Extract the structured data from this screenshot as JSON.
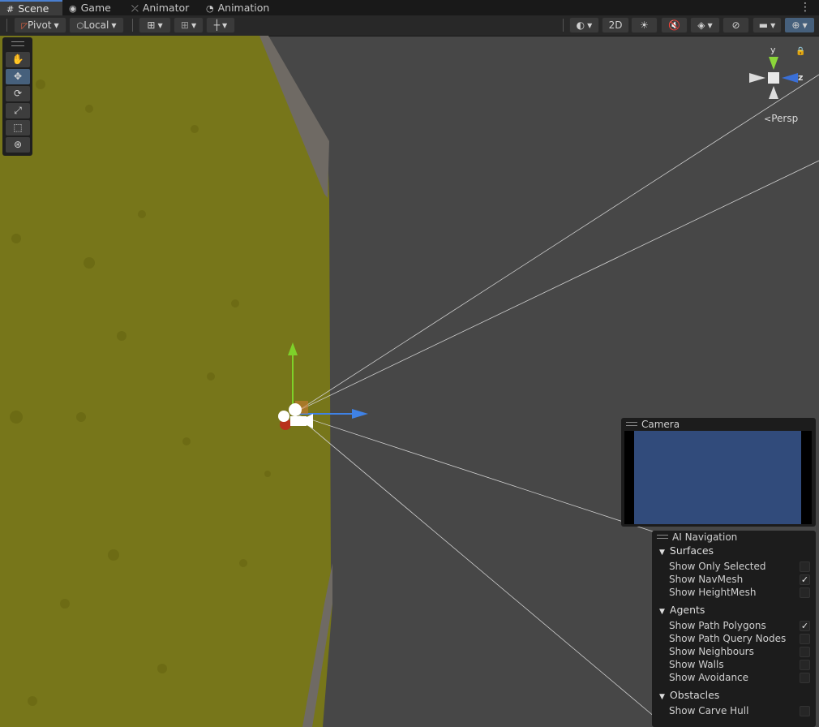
{
  "tabs": [
    {
      "label": "Scene",
      "icon": "grid-icon",
      "glyph": "#"
    },
    {
      "label": "Game",
      "icon": "gamepad-icon",
      "glyph": "◉"
    },
    {
      "label": "Animator",
      "icon": "animator-icon",
      "glyph": "⤫"
    },
    {
      "label": "Animation",
      "icon": "clock-icon",
      "glyph": "◔"
    }
  ],
  "toolbar": {
    "pivot_label": "Pivot",
    "local_label": "Local",
    "mode_2d_label": "2D"
  },
  "scene_tools": [
    {
      "name": "hand-tool",
      "glyph": "✋"
    },
    {
      "name": "move-tool",
      "glyph": "✥"
    },
    {
      "name": "rotate-tool",
      "glyph": "⟳"
    },
    {
      "name": "scale-tool",
      "glyph": "⤢"
    },
    {
      "name": "rect-tool",
      "glyph": "⬚"
    },
    {
      "name": "transform-tool",
      "glyph": "⊛"
    }
  ],
  "gizmo": {
    "projection_label": "Persp",
    "y_axis": "y",
    "z_axis": "z"
  },
  "camera_overlay": {
    "title": "Camera",
    "preview_color": "#314b7b"
  },
  "ai_navigation": {
    "title": "AI Navigation",
    "surfaces": {
      "label": "Surfaces",
      "items": [
        {
          "label": "Show Only Selected",
          "checked": false
        },
        {
          "label": "Show NavMesh",
          "checked": true
        },
        {
          "label": "Show HeightMesh",
          "checked": false
        }
      ]
    },
    "agents": {
      "label": "Agents",
      "items": [
        {
          "label": "Show Path Polygons",
          "checked": true
        },
        {
          "label": "Show Path Query Nodes",
          "checked": false
        },
        {
          "label": "Show Neighbours",
          "checked": false
        },
        {
          "label": "Show Walls",
          "checked": false
        },
        {
          "label": "Show Avoidance",
          "checked": false
        }
      ]
    },
    "obstacles": {
      "label": "Obstacles",
      "items": [
        {
          "label": "Show Carve Hull",
          "checked": false
        }
      ]
    }
  },
  "colors": {
    "grass": "#77761a",
    "wall": "#6f6a64",
    "accent": "#4a7fd0",
    "camera_preview": "#314b7b"
  }
}
